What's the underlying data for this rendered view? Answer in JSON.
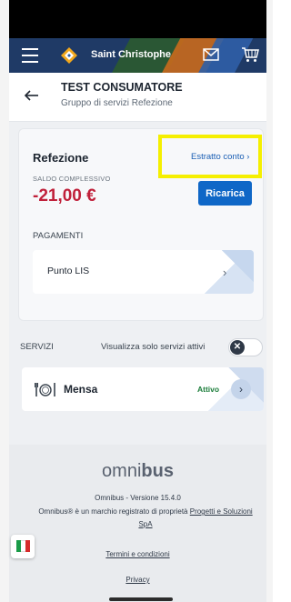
{
  "appbar": {
    "brand": "Saint Christophe",
    "icons": [
      "menu-icon",
      "logo-icon",
      "mail-icon",
      "cart-icon"
    ],
    "color": "#1f3a66"
  },
  "header": {
    "title": "TEST CONSUMATORE",
    "subtitle": "Gruppo di servizi Refezione"
  },
  "card": {
    "title": "Refezione",
    "statement_link": "Estratto conto ›",
    "balance_label": "SALDO COMPLESSIVO",
    "balance_value": "-21,00 €",
    "recharge_label": "Ricarica",
    "payments_label": "PAGAMENTI",
    "payment_methods": [
      {
        "label": "Punto LIS"
      }
    ]
  },
  "services": {
    "label": "SERVIZI",
    "filter_label": "Visualizza solo servizi attivi",
    "filter_enabled": false,
    "items": [
      {
        "name": "Mensa",
        "status": "Attivo"
      }
    ]
  },
  "footer": {
    "logo_light": "omni",
    "logo_bold": "bus",
    "version": "Omnibus - Versione 15.4.0",
    "trademark_text": "Omnibus® è un marchio registrato di proprietà ",
    "trademark_link": "Progetti e Soluzioni SpA",
    "terms": "Termini e condizioni",
    "privacy": "Privacy"
  },
  "language": "it",
  "colors": {
    "accent": "#0f67c7",
    "negative": "#c0203a",
    "active": "#1b7d3a",
    "highlight": "#f5ef00"
  }
}
